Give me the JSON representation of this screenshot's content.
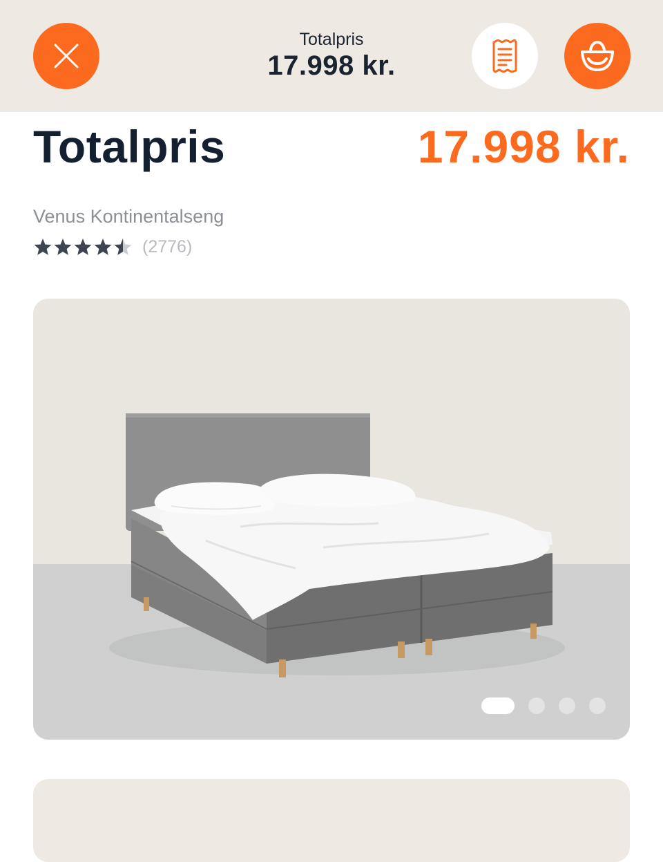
{
  "header": {
    "label": "Totalpris",
    "price": "17.998 kr.",
    "close_icon": "close-icon",
    "receipt_icon": "receipt-icon",
    "cart_icon": "shopping-basket-icon"
  },
  "summary": {
    "title": "Totalpris",
    "price": "17.998 kr."
  },
  "product": {
    "name": "Venus Kontinentalseng",
    "rating": 4.5,
    "rating_max": 5,
    "review_count": "(2776)"
  },
  "gallery": {
    "image": "continental-bed-photo",
    "slide_count": 4,
    "active_slide": 1
  },
  "colors": {
    "accent": "#fb6a1e",
    "header_bg": "#efe9e3",
    "text_dark": "#142030",
    "text_muted": "#8b8f96"
  }
}
